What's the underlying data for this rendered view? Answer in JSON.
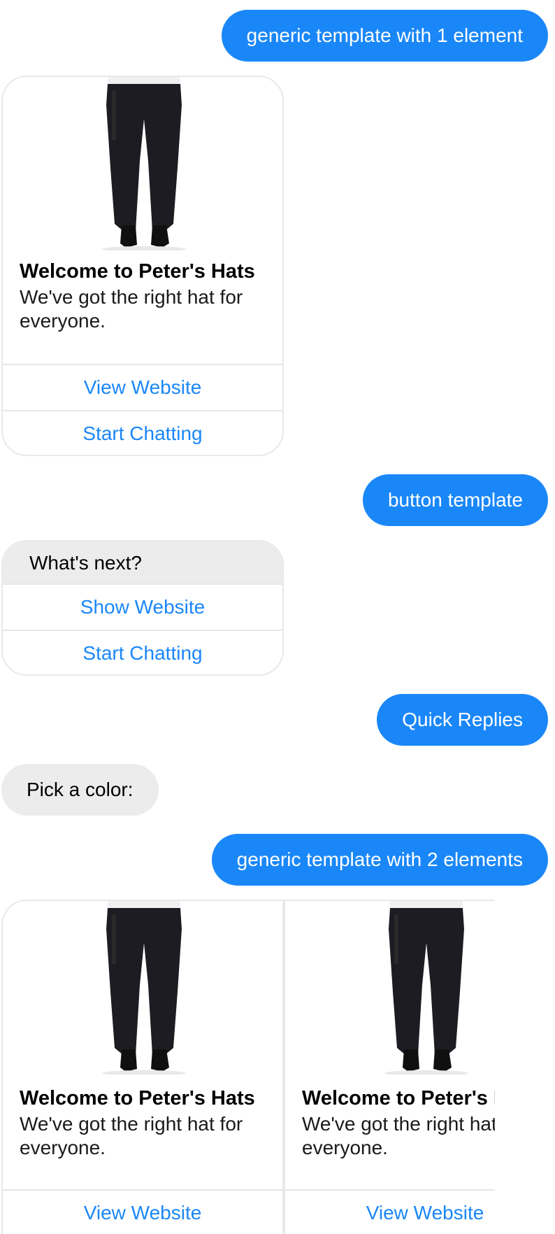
{
  "messages": {
    "user_1": "generic template with 1 element",
    "generic_card": {
      "title": "Welcome to Peter's Hats",
      "subtitle": "We've got the right hat for everyone.",
      "buttons": [
        "View Website",
        "Start Chatting"
      ]
    },
    "user_2": "button template",
    "button_template": {
      "text": "What's next?",
      "buttons": [
        "Show Website",
        "Start Chatting"
      ]
    },
    "user_3": "Quick Replies",
    "bot_text": "Pick a color:",
    "user_4": "generic template with 2 elements",
    "carousel": [
      {
        "title": "Welcome to Peter's Hats",
        "subtitle": "We've got the right hat for everyone.",
        "button": "View Website"
      },
      {
        "title": "Welcome to Peter's Hats",
        "subtitle": "We've got the right hat for everyone.",
        "button": "View Website"
      }
    ]
  },
  "colors": {
    "accent": "#1a87f8",
    "bot_bubble": "#ececec",
    "border": "#e9e9e9"
  },
  "icons": {
    "product_image": "black-cargo-pants-photo"
  }
}
